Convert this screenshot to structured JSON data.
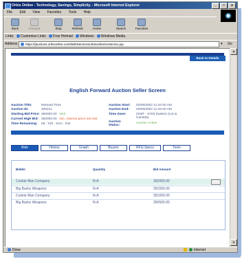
{
  "window": {
    "title": "Orbis Online - Technology, Savings, Simplicity. - Microsoft Internet Explorer",
    "controls": [
      "_",
      "□",
      "x"
    ]
  },
  "menu": [
    "File",
    "Edit",
    "View",
    "Favorites",
    "Tools",
    "Help"
  ],
  "toolbar": {
    "back": "Back",
    "forward": "Forward",
    "stop": "Stop",
    "refresh": "Refresh",
    "home": "Home",
    "search": "Search",
    "favorites": "Favorites"
  },
  "links": {
    "label": "Links",
    "items": [
      "Customize Links",
      "Free Hotmail",
      "Windows",
      "Windows Media"
    ]
  },
  "address": {
    "label": "Address",
    "url": "https://[auctions.orbisonline.com/WebServices/orbisonline/xxService.jsp",
    "go": "Go"
  },
  "page": {
    "back_button": "Back to Details",
    "title": "English Forward Auction Seller Screen",
    "fields": {
      "auction_title_label": "Auction Title:",
      "auction_title_value": "Retread Tires",
      "auction_id_label": "Auction ID:",
      "auction_id_value": "400211",
      "starting_bid_label": "Starting Bid Price:",
      "starting_bid_value": "350000.00",
      "starting_bid_note": "Visit",
      "current_high_label": "Current High Bid:",
      "current_high_value": "352000.00",
      "current_high_note": "min. reserve price not met",
      "time_remaining_label": "Time Remaining:",
      "time_remaining_value": "0d : 22h : 51m : 04s",
      "auction_start_label": "Auction Start:",
      "auction_start_value": "02/08/2002 11:32:00 AM",
      "auction_end_label": "Auction End:",
      "auction_end_value": "03/08/2002 11:32:00 AM",
      "time_zone_label": "Time Zone:",
      "time_zone_value_1": "(GMT - 6:00) Eastern (US &",
      "time_zone_value_2": "Canada)",
      "auction_status_label_1": "Auction",
      "auction_status_label_2": "Status:",
      "auction_status_value": "Auction Active"
    },
    "tabs": [
      "Bids",
      "History",
      "Graph",
      "Buyers",
      "RFQ Specs",
      "Tools"
    ],
    "table": {
      "headers": [
        "Bidder",
        "Quantity",
        "Bid Amount"
      ],
      "rows": [
        {
          "bidder": "Cookie Man Company",
          "quantity": "N-A",
          "amount": "352000.00"
        },
        {
          "bidder": "Big Backs Weapons",
          "quantity": "N-A",
          "amount": "351500.00"
        },
        {
          "bidder": "Cookie Man Company",
          "quantity": "N-A",
          "amount": "351000.00"
        },
        {
          "bidder": "Big Backs Weapons",
          "quantity": "N-A",
          "amount": "350500.00"
        }
      ]
    }
  },
  "status": {
    "left": "Done",
    "zone": "Internet"
  },
  "colors": {
    "title_bar": "#0a246a",
    "page_blue": "#1a3e8f",
    "accent_green": "#6aa84f",
    "accent_red": "#e8541f",
    "highlight_row": "#dff2ee"
  }
}
